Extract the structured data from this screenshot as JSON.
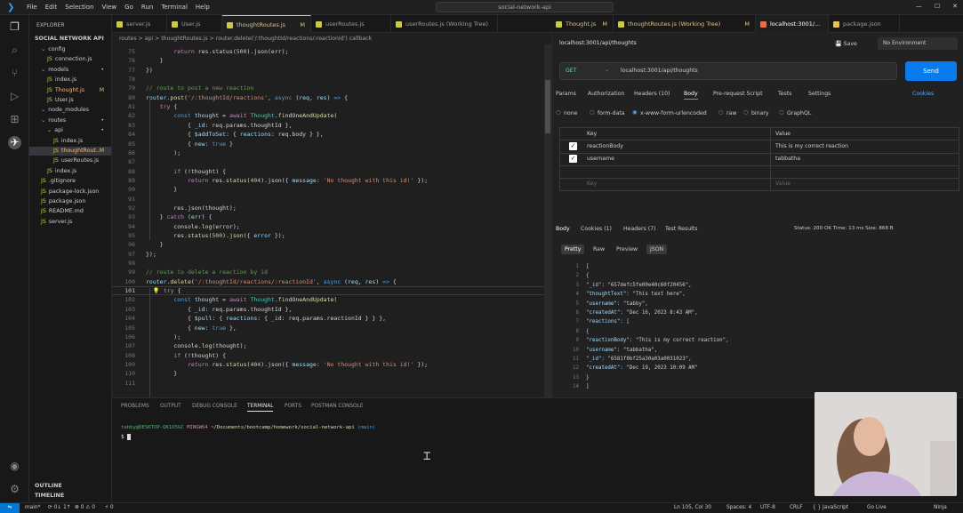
{
  "titlebar": {
    "menu": [
      "File",
      "Edit",
      "Selection",
      "View",
      "Go",
      "Run",
      "Terminal",
      "Help"
    ],
    "search": "social-network-api"
  },
  "sidebar": {
    "header": "EXPLORER",
    "root": "SOCIAL NETWORK API",
    "items": [
      {
        "label": "config",
        "indent": 1,
        "folder": true,
        "badge": ""
      },
      {
        "label": "connection.js",
        "indent": 2,
        "folder": false,
        "badge": ""
      },
      {
        "label": "models",
        "indent": 1,
        "folder": true,
        "badge": "•"
      },
      {
        "label": "index.js",
        "indent": 2,
        "folder": false,
        "badge": ""
      },
      {
        "label": "Thought.js",
        "indent": 2,
        "folder": false,
        "badge": "M"
      },
      {
        "label": "User.js",
        "indent": 2,
        "folder": false,
        "badge": ""
      },
      {
        "label": "node_modules",
        "indent": 1,
        "folder": true,
        "badge": ""
      },
      {
        "label": "routes",
        "indent": 1,
        "folder": true,
        "badge": "•"
      },
      {
        "label": "api",
        "indent": 2,
        "folder": true,
        "badge": "•"
      },
      {
        "label": "index.js",
        "indent": 3,
        "folder": false,
        "badge": ""
      },
      {
        "label": "thoughtRout...",
        "indent": 3,
        "folder": false,
        "badge": "M"
      },
      {
        "label": "userRoutes.js",
        "indent": 3,
        "folder": false,
        "badge": ""
      },
      {
        "label": "index.js",
        "indent": 2,
        "folder": false,
        "badge": ""
      },
      {
        "label": ".gitignore",
        "indent": 1,
        "folder": false,
        "badge": ""
      },
      {
        "label": "package-lock.json",
        "indent": 1,
        "folder": false,
        "badge": ""
      },
      {
        "label": "package.json",
        "indent": 1,
        "folder": false,
        "badge": ""
      },
      {
        "label": "README.md",
        "indent": 1,
        "folder": false,
        "badge": ""
      },
      {
        "label": "server.js",
        "indent": 1,
        "folder": false,
        "badge": ""
      }
    ],
    "outline": "OUTLINE",
    "timeline": "TIMELINE"
  },
  "editor_tabs": [
    {
      "label": "server.js",
      "modified": "",
      "active": false
    },
    {
      "label": "User.js",
      "modified": "",
      "active": false
    },
    {
      "label": "thoughtRoutes.js",
      "modified": "M",
      "active": true
    },
    {
      "label": "userRoutes.js",
      "modified": "",
      "active": false
    },
    {
      "label": "userRoutes.js (Working Tree)",
      "modified": "",
      "active": false
    }
  ],
  "right_tabs": [
    {
      "label": "Thought.js",
      "modified": "M"
    },
    {
      "label": "thoughtRoutes.js (Working Tree)",
      "modified": "M"
    },
    {
      "label": "localhost:3001/...",
      "modified": ""
    },
    {
      "label": "package.json",
      "modified": ""
    }
  ],
  "breadcrumb": "routes > api > thoughtRoutes.js > router.delete('/:thoughtId/reactions/:reactionId') callback",
  "code": {
    "lines": [
      {
        "n": "75",
        "html": "        <span class='kw'>return</span> res.status(<span class='num'>500</span>).json(err);"
      },
      {
        "n": "76",
        "html": "    }"
      },
      {
        "n": "77",
        "html": "})"
      },
      {
        "n": "78",
        "html": ""
      },
      {
        "n": "79",
        "html": "<span class='cm'>// route to post a new reaction</span>"
      },
      {
        "n": "80",
        "html": "<span class='var'>router</span>.<span class='fn'>post</span>(<span class='str'>'/:thoughtId/reactions'</span>, <span class='kw2'>async</span> (<span class='var'>req</span>, <span class='var'>res</span>) <span class='kw2'>=&gt;</span> {"
      },
      {
        "n": "81",
        "html": "    <span class='kw'>try</span> {"
      },
      {
        "n": "82",
        "html": "        <span class='kw2'>const</span> <span class='var'>thought</span> = <span class='kw'>await</span> <span class='cls'>Thought</span>.<span class='fn'>findOneAndUpdate</span>("
      },
      {
        "n": "83",
        "html": "            { <span class='var'>_id</span>: req.params.thoughtId },"
      },
      {
        "n": "84",
        "html": "            { <span class='var'>$addToSet</span>: { <span class='var'>reactions</span>: req.body } },"
      },
      {
        "n": "85",
        "html": "            { <span class='var'>new</span>: <span class='kw2'>true</span> }"
      },
      {
        "n": "86",
        "html": "        );"
      },
      {
        "n": "87",
        "html": ""
      },
      {
        "n": "88",
        "html": "        <span class='kw'>if</span> (!thought) {"
      },
      {
        "n": "89",
        "html": "            <span class='kw'>return</span> res.<span class='fn'>status</span>(<span class='num'>404</span>).<span class='fn'>json</span>({ <span class='var'>message</span>: <span class='str'>'No thought with this id!'</span> });"
      },
      {
        "n": "90",
        "html": "        }"
      },
      {
        "n": "91",
        "html": ""
      },
      {
        "n": "92",
        "html": "        res.<span class='fn'>json</span>(thought);"
      },
      {
        "n": "93",
        "html": "    } <span class='kw'>catch</span> (<span class='var'>err</span>) {"
      },
      {
        "n": "94",
        "html": "        console.<span class='fn'>log</span>(error);"
      },
      {
        "n": "95",
        "html": "        res.<span class='fn'>status</span>(<span class='num'>500</span>).<span class='fn'>json</span>({ <span class='var'>error</span> });"
      },
      {
        "n": "96",
        "html": "    }"
      },
      {
        "n": "97",
        "html": "});"
      },
      {
        "n": "98",
        "html": ""
      },
      {
        "n": "99",
        "html": "<span class='cm'>// route to delete a reaction by id</span>"
      },
      {
        "n": "100",
        "html": "<span class='var'>router</span>.<span class='fn'>delete</span>(<span class='str'>'/:thoughtId/reactions/:reactionId'</span>, <span class='kw2'>async</span> (<span class='var'>req</span>, <span class='var'>res</span>) <span class='kw2'>=&gt;</span> {"
      },
      {
        "n": "101",
        "html": "  <span style='color:#cca700'>💡</span> <span class='kw'>try</span> {"
      },
      {
        "n": "102",
        "html": "        <span class='kw2'>const</span> <span class='var'>thought</span> = <span class='kw'>await</span> <span class='cls'>Thought</span>.<span class='fn'>findOneAndUpdate</span>("
      },
      {
        "n": "103",
        "html": "            { <span class='var'>_id</span>: req.params.thoughtId },"
      },
      {
        "n": "104",
        "html": "            { <span class='var'>$pull</span>: { <span class='var'>reactions</span>: { <span class='var'>_id</span>: req.params.reactionId } } },"
      },
      {
        "n": "105",
        "html": "            { <span class='var'>new</span>: <span class='kw2'>true</span> },"
      },
      {
        "n": "106",
        "html": "        );"
      },
      {
        "n": "107",
        "html": "        console.<span class='fn'>log</span>(thought);"
      },
      {
        "n": "108",
        "html": "        <span class='kw'>if</span> (!thought) {"
      },
      {
        "n": "109",
        "html": "            <span class='kw'>return</span> res.<span class='fn'>status</span>(<span class='num'>404</span>).<span class='fn'>json</span>({ <span class='var'>message</span>: <span class='str'>'No thought with this id!'</span> });"
      },
      {
        "n": "110",
        "html": "        }"
      },
      {
        "n": "111",
        "html": ""
      }
    ],
    "current_line": "101"
  },
  "panel": {
    "tabs": [
      "PROBLEMS",
      "OUTPUT",
      "DEBUG CONSOLE",
      "TERMINAL",
      "PORTS",
      "POSTMAN CONSOLE"
    ],
    "active": "TERMINAL",
    "prompt_user": "tabby@DESKTOP-QK1O5GC",
    "prompt_env": "MINGW64",
    "prompt_path": "~/Documents/bootcamp/homework/social-network-api",
    "prompt_branch": "(main)",
    "prompt_symbol": "$"
  },
  "postman": {
    "url_tab": "localhost:3001/api/thoughts",
    "save": "Save",
    "env": "No Environment",
    "method": "GET",
    "url": "localhost:3001/api/thoughts",
    "send": "Send",
    "req_tabs": [
      "Params",
      "Authorization",
      "Headers (10)",
      "Body",
      "Pre-request Script",
      "Tests",
      "Settings"
    ],
    "cookies": "Cookies",
    "body_types": [
      "none",
      "form-data",
      "x-www-form-urlencoded",
      "raw",
      "binary",
      "GraphQL"
    ],
    "kv_header": {
      "key": "Key",
      "value": "Value"
    },
    "kv_rows": [
      {
        "key": "reactionBody",
        "value": "This is my correct reaction"
      },
      {
        "key": "username",
        "value": "tabbatha"
      }
    ],
    "kv_placeholder": {
      "key": "Key",
      "value": "Value"
    },
    "resp_tabs": [
      "Body",
      "Cookies (1)",
      "Headers (7)",
      "Test Results"
    ],
    "status": "Status: 200 OK  Time: 13 ms  Size: 868 B",
    "view_tabs": [
      "Pretty",
      "Raw",
      "Preview",
      "JSON"
    ],
    "json_lines": [
      {
        "n": "1",
        "t": "["
      },
      {
        "n": "2",
        "t": "    {"
      },
      {
        "n": "3",
        "t": "        \"_id\": \"657defc5fe00e40c60f20456\","
      },
      {
        "n": "4",
        "t": "        \"thoughtText\": \"This text here\","
      },
      {
        "n": "5",
        "t": "        \"username\": \"tabby\","
      },
      {
        "n": "6",
        "t": "        \"createdAt\": \"Dec 16, 2023 8:43 AM\","
      },
      {
        "n": "7",
        "t": "        \"reactions\": ["
      },
      {
        "n": "8",
        "t": "            {"
      },
      {
        "n": "9",
        "t": "                \"reactionBody\": \"This is my correct reaction\","
      },
      {
        "n": "10",
        "t": "                \"username\": \"tabbatha\","
      },
      {
        "n": "11",
        "t": "                \"_id\": \"6581f0bf25a30a03a0031023\","
      },
      {
        "n": "12",
        "t": "                \"createdAt\": \"Dec 19, 2023 10:09 AM\""
      },
      {
        "n": "13",
        "t": "            }"
      },
      {
        "n": "14",
        "t": "        ]"
      }
    ]
  },
  "statusbar": {
    "left": [
      "main*",
      "⟳ 0↓ 1↑",
      "⊗ 0 ⚠ 0",
      "⚡ 0"
    ],
    "right": [
      "Ln 105, Col 30",
      "Spaces: 4",
      "UTF-8",
      "CRLF",
      "{ } JavaScript",
      "Go Live",
      "Ninja"
    ]
  },
  "colors": {
    "accent": "#0078d4",
    "send": "#097bed",
    "modified": "#e2c08d",
    "status_ok": "#49b86f"
  }
}
